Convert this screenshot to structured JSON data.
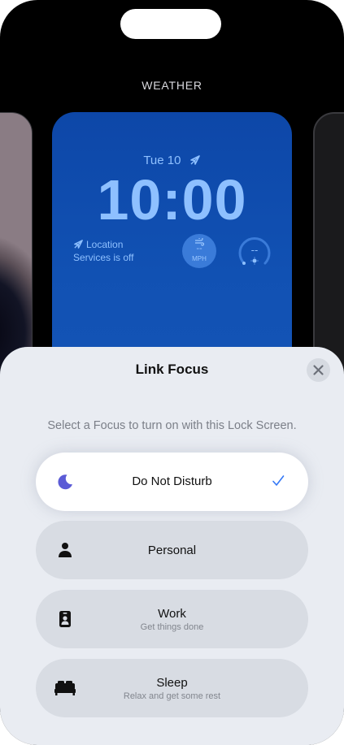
{
  "lock_screen": {
    "section_title": "WEATHER",
    "date": "Tue 10",
    "time": "10:00",
    "location_line1": "Location",
    "location_line2": "Services is off",
    "wind_value": "--",
    "wind_unit": "MPH",
    "gauge_value": "--"
  },
  "sheet": {
    "title": "Link Focus",
    "subtitle": "Select a Focus to turn on with this Lock Screen.",
    "options": [
      {
        "label": "Do Not Disturb",
        "subtitle": "",
        "icon": "moon-icon",
        "selected": true
      },
      {
        "label": "Personal",
        "subtitle": "",
        "icon": "person-icon",
        "selected": false
      },
      {
        "label": "Work",
        "subtitle": "Get things done",
        "icon": "id-badge-icon",
        "selected": false
      },
      {
        "label": "Sleep",
        "subtitle": "Relax and get some rest",
        "icon": "bed-icon",
        "selected": false
      }
    ]
  },
  "colors": {
    "accent": "#3478f6",
    "moon": "#5b5bd6",
    "card": "#0d47a8",
    "widget_text": "#8ec0ff"
  }
}
